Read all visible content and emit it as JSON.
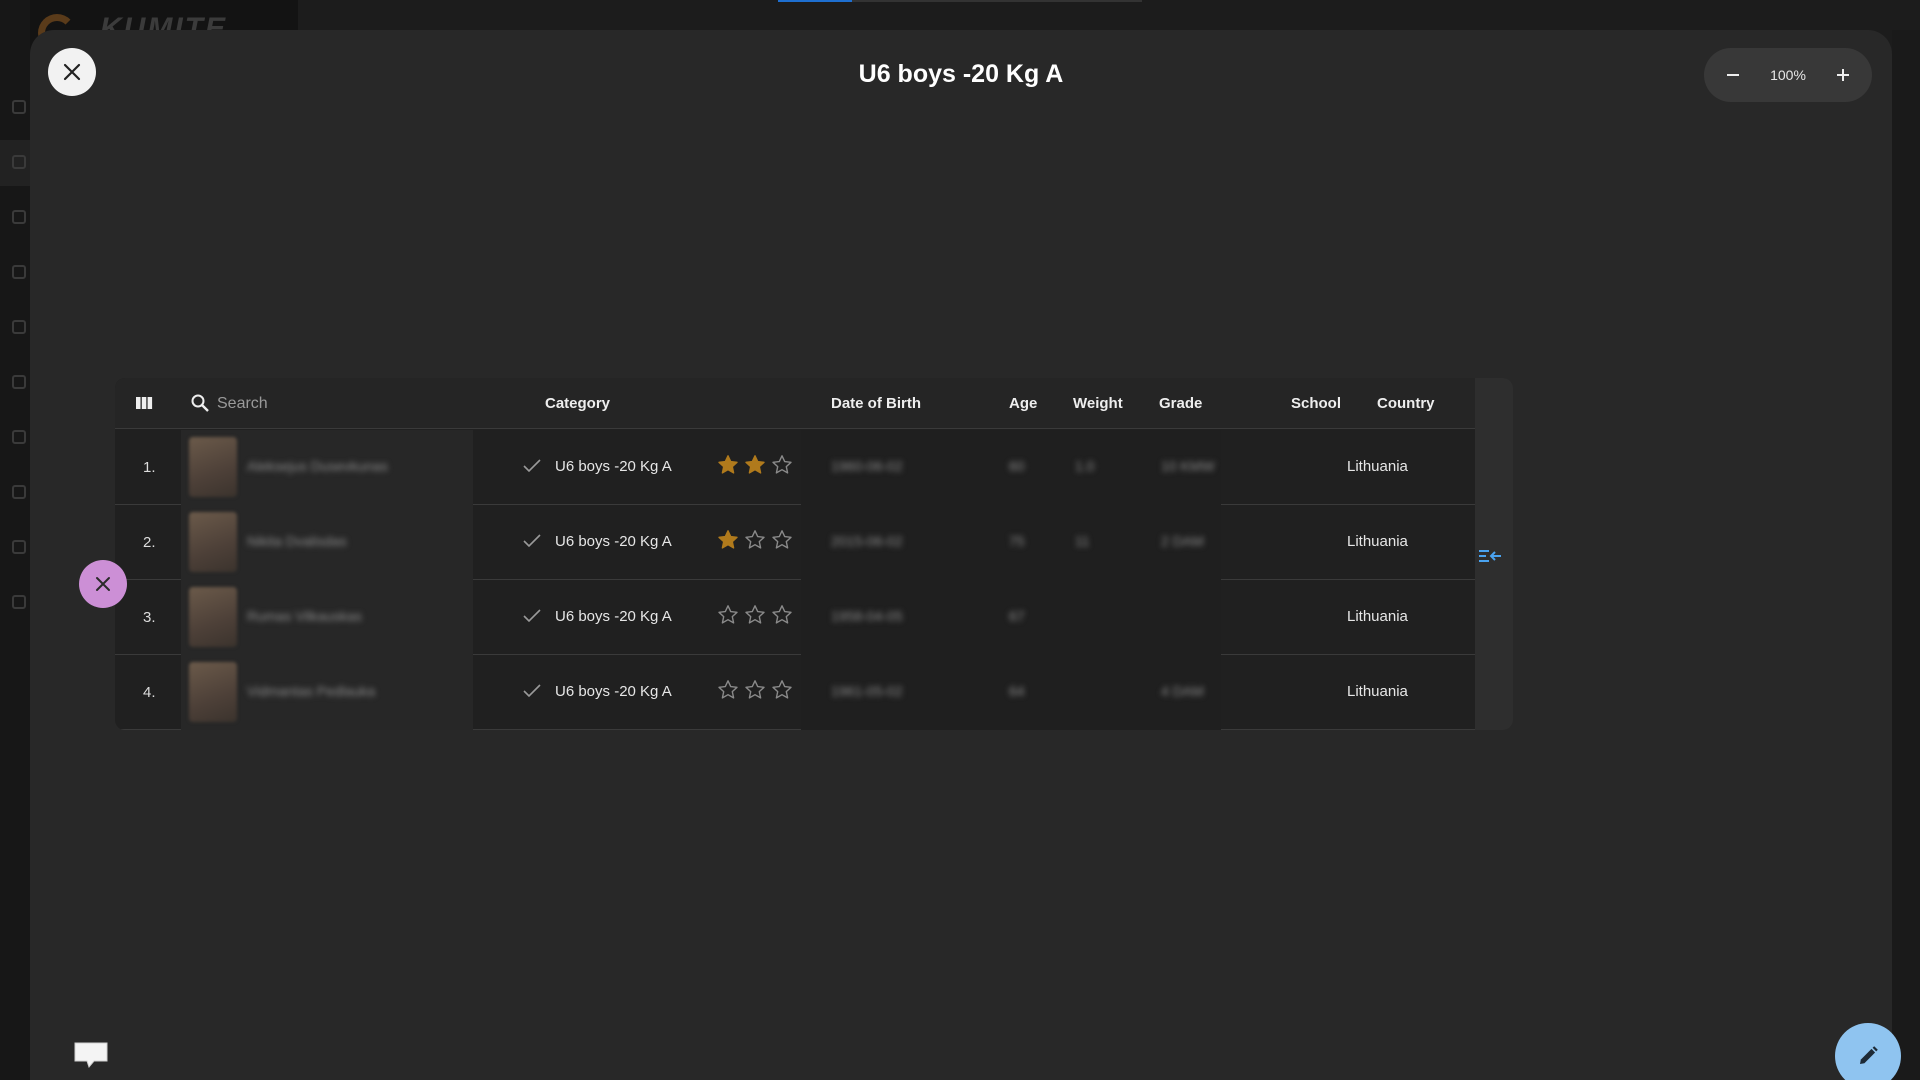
{
  "app": {
    "logo_text": "KUMITE"
  },
  "dialog": {
    "title": "U6 boys -20 Kg A",
    "zoom": {
      "value": "100%"
    }
  },
  "table": {
    "search_placeholder": "Search",
    "headers": {
      "category": "Category",
      "dob": "Date of Birth",
      "age": "Age",
      "weight": "Weight",
      "grade": "Grade",
      "school": "School",
      "country": "Country"
    },
    "rows": [
      {
        "num": "1.",
        "name": "Aleksejus Dusevkunas",
        "category": "U6 boys -20 Kg A",
        "stars": 2,
        "dob": "1960-06-02",
        "age": "60",
        "weight": "1.0",
        "grade": "10 KMW",
        "country": "Lithuania"
      },
      {
        "num": "2.",
        "name": "Nikita Dvalisdas",
        "category": "U6 boys -20 Kg A",
        "stars": 1,
        "dob": "2015-06-02",
        "age": "75",
        "weight": "11",
        "grade": "2 DAM",
        "country": "Lithuania"
      },
      {
        "num": "3.",
        "name": "Rumas Vilkauskas",
        "category": "U6 boys -20 Kg A",
        "stars": 0,
        "dob": "1958-04-05",
        "age": "67",
        "weight": "",
        "grade": "",
        "country": "Lithuania"
      },
      {
        "num": "4.",
        "name": "Vidmantas Pedlauka",
        "category": "U6 boys -20 Kg A",
        "stars": 0,
        "dob": "1961-05-02",
        "age": "64",
        "weight": "",
        "grade": "4 DAM",
        "country": "Lithuania"
      }
    ]
  },
  "colors": {
    "star_filled": "#b07a1c",
    "star_empty": "#8a8a8a",
    "fab_close": "#cc8fd6",
    "fab_edit": "#8fc4f0",
    "accent": "#1e6fd0"
  },
  "icons": [
    "close-icon",
    "minus-icon",
    "plus-icon",
    "columns-icon",
    "search-icon",
    "check-icon",
    "star-icon",
    "collapse-panel-icon",
    "pencil-icon",
    "chat-icon"
  ]
}
